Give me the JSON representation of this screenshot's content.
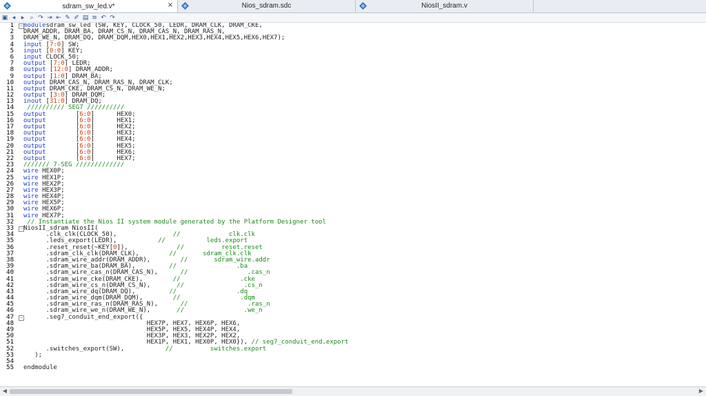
{
  "tabs": [
    {
      "label": "sdram_sw_led.v*",
      "active": true,
      "width": 258
    },
    {
      "label": "Nios_sdram.sdc",
      "active": false,
      "width": 258
    },
    {
      "label": "NiosII_sdram.v",
      "active": false,
      "width": 258
    }
  ],
  "tab_close_glyph": "×",
  "editor": {
    "lines": [
      {
        "n": "1",
        "fold": "minus",
        "seg": [
          [
            "kw",
            "module"
          ],
          [
            "",
            "sdram_sw_led (SW, KEY, CLOCK_50, LEDR, DRAM_CLK, DRAM_CKE,"
          ]
        ]
      },
      {
        "n": "2",
        "seg": [
          [
            "",
            "DRAM_ADDR, DRAM_BA, DRAM_CS_N, DRAM_CAS_N, DRAM_RAS_N,"
          ]
        ]
      },
      {
        "n": "3",
        "seg": [
          [
            "",
            "DRAM_WE_N, DRAM_DQ, DRAM_DQM,HEX0,HEX1,HEX2,HEX3,HEX4,HEX5,HEX6,HEX7);"
          ]
        ]
      },
      {
        "n": "4",
        "seg": [
          [
            "kw",
            "input"
          ],
          [
            "",
            " "
          ],
          [
            "",
            "["
          ],
          [
            "num",
            "7:0"
          ],
          [
            "",
            "] SW;"
          ]
        ]
      },
      {
        "n": "5",
        "seg": [
          [
            "kw",
            "input"
          ],
          [
            "",
            " ["
          ],
          [
            "num",
            "0:0"
          ],
          [
            "",
            "] KEY;"
          ]
        ]
      },
      {
        "n": "6",
        "seg": [
          [
            "kw",
            "input"
          ],
          [
            "",
            " CLOCK_50;"
          ]
        ]
      },
      {
        "n": "7",
        "seg": [
          [
            "kw",
            "output"
          ],
          [
            "",
            " ["
          ],
          [
            "num",
            "7:0"
          ],
          [
            "",
            "] LEDR;"
          ]
        ]
      },
      {
        "n": "8",
        "seg": [
          [
            "kw",
            "output"
          ],
          [
            "",
            " ["
          ],
          [
            "num",
            "12:0"
          ],
          [
            "",
            "] DRAM_ADDR;"
          ]
        ]
      },
      {
        "n": "9",
        "seg": [
          [
            "kw",
            "output"
          ],
          [
            "",
            " ["
          ],
          [
            "num",
            "1:0"
          ],
          [
            "",
            "] DRAM_BA;"
          ]
        ]
      },
      {
        "n": "10",
        "seg": [
          [
            "kw",
            "output"
          ],
          [
            "",
            " DRAM_CAS_N, DRAM_RAS_N, DRAM_CLK;"
          ]
        ]
      },
      {
        "n": "11",
        "seg": [
          [
            "kw",
            "output"
          ],
          [
            "",
            " DRAM_CKE, DRAM_CS_N, DRAM_WE_N;"
          ]
        ]
      },
      {
        "n": "12",
        "seg": [
          [
            "kw",
            "output"
          ],
          [
            "",
            " ["
          ],
          [
            "num",
            "3:0"
          ],
          [
            "",
            "] DRAM_DQM;"
          ]
        ]
      },
      {
        "n": "13",
        "seg": [
          [
            "kw",
            "inout"
          ],
          [
            "",
            " ["
          ],
          [
            "num",
            "31:0"
          ],
          [
            "",
            "] DRAM_DQ;"
          ]
        ]
      },
      {
        "n": "14",
        "seg": [
          [
            "cm",
            " ////////// SEG7 //////////"
          ]
        ]
      },
      {
        "n": "15",
        "seg": [
          [
            "kw",
            "output"
          ],
          [
            "",
            "        ["
          ],
          [
            "num",
            "6:0"
          ],
          [
            "",
            "]      HEX0;"
          ]
        ]
      },
      {
        "n": "16",
        "seg": [
          [
            "kw",
            "output"
          ],
          [
            "",
            "        ["
          ],
          [
            "num",
            "6:0"
          ],
          [
            "",
            "]      HEX1;"
          ]
        ]
      },
      {
        "n": "17",
        "seg": [
          [
            "kw",
            "output"
          ],
          [
            "",
            "        ["
          ],
          [
            "num",
            "6:0"
          ],
          [
            "",
            "]      HEX2;"
          ]
        ]
      },
      {
        "n": "18",
        "seg": [
          [
            "kw",
            "output"
          ],
          [
            "",
            "        ["
          ],
          [
            "num",
            "6:0"
          ],
          [
            "",
            "]      HEX3;"
          ]
        ]
      },
      {
        "n": "19",
        "seg": [
          [
            "kw",
            "output"
          ],
          [
            "",
            "        ["
          ],
          [
            "num",
            "6:0"
          ],
          [
            "",
            "]      HEX4;"
          ]
        ]
      },
      {
        "n": "20",
        "seg": [
          [
            "kw",
            "output"
          ],
          [
            "",
            "        ["
          ],
          [
            "num",
            "6:0"
          ],
          [
            "",
            "]      HEX5;"
          ]
        ]
      },
      {
        "n": "21",
        "seg": [
          [
            "kw",
            "output"
          ],
          [
            "",
            "        ["
          ],
          [
            "num",
            "6:0"
          ],
          [
            "",
            "]      HEX6;"
          ]
        ]
      },
      {
        "n": "22",
        "seg": [
          [
            "kw",
            "output"
          ],
          [
            "",
            "        ["
          ],
          [
            "num",
            "6:0"
          ],
          [
            "",
            "]      HEX7;"
          ]
        ]
      },
      {
        "n": "23",
        "seg": [
          [
            "cm",
            "/////// 7-SEG /////////////"
          ]
        ]
      },
      {
        "n": "24",
        "seg": [
          [
            "kw",
            "wire"
          ],
          [
            "",
            " HEX0P;"
          ]
        ]
      },
      {
        "n": "25",
        "seg": [
          [
            "kw",
            "wire"
          ],
          [
            "",
            " HEX1P;"
          ]
        ]
      },
      {
        "n": "26",
        "seg": [
          [
            "kw",
            "wire"
          ],
          [
            "",
            " HEX2P;"
          ]
        ]
      },
      {
        "n": "27",
        "seg": [
          [
            "kw",
            "wire"
          ],
          [
            "",
            " HEX3P;"
          ]
        ]
      },
      {
        "n": "28",
        "seg": [
          [
            "kw",
            "wire"
          ],
          [
            "",
            " HEX4P;"
          ]
        ]
      },
      {
        "n": "29",
        "seg": [
          [
            "kw",
            "wire"
          ],
          [
            "",
            " HEX5P;"
          ]
        ]
      },
      {
        "n": "30",
        "seg": [
          [
            "kw",
            "wire"
          ],
          [
            "",
            " HEX6P;"
          ]
        ]
      },
      {
        "n": "31",
        "seg": [
          [
            "kw",
            "wire"
          ],
          [
            "",
            " HEX7P;"
          ]
        ]
      },
      {
        "n": "32",
        "seg": [
          [
            "cm",
            " // Instantiate the Nios II system module generated by the Platform Designer tool"
          ]
        ]
      },
      {
        "n": "33",
        "fold": "minus",
        "seg": [
          [
            "",
            "NiosII_sdram NiosII("
          ]
        ]
      },
      {
        "n": "34",
        "seg": [
          [
            "",
            "      .clk_clk(CLOCK_50),               "
          ],
          [
            "cm",
            "//             clk.clk"
          ]
        ]
      },
      {
        "n": "35",
        "seg": [
          [
            "",
            "      .leds_export(LEDR),           "
          ],
          [
            "cm",
            "//           leds.export"
          ]
        ]
      },
      {
        "n": "36",
        "seg": [
          [
            "",
            "      .reset_reset(~KEY["
          ],
          [
            "num",
            "0"
          ],
          [
            "",
            "]),             "
          ],
          [
            "cm",
            "//          reset.reset"
          ]
        ]
      },
      {
        "n": "37",
        "seg": [
          [
            "",
            "      .sdram_clk_clk(DRAM_CLK),        "
          ],
          [
            "cm",
            "//       sdram_clk.clk"
          ]
        ]
      },
      {
        "n": "38",
        "seg": [
          [
            "",
            "      .sdram_wire_addr(DRAM_ADDR),        "
          ],
          [
            "cm",
            "//       sdram_wire.addr"
          ]
        ]
      },
      {
        "n": "39",
        "seg": [
          [
            "",
            "      .sdram_wire_ba(DRAM_BA),         "
          ],
          [
            "cm",
            "//                .ba"
          ]
        ]
      },
      {
        "n": "40",
        "seg": [
          [
            "",
            "      .sdram_wire_cas_n(DRAM_CAS_N),      "
          ],
          [
            "cm",
            "//                .cas_n"
          ]
        ]
      },
      {
        "n": "41",
        "seg": [
          [
            "",
            "      .sdram_wire_cke(DRAM_CKE),        "
          ],
          [
            "cm",
            "//                .cke"
          ]
        ]
      },
      {
        "n": "42",
        "seg": [
          [
            "",
            "      .sdram_wire_cs_n(DRAM_CS_N),       "
          ],
          [
            "cm",
            "//                .cs_n"
          ]
        ]
      },
      {
        "n": "43",
        "seg": [
          [
            "",
            "      .sdram_wire_dq(DRAM_DQ),         "
          ],
          [
            "cm",
            "//                .dq"
          ]
        ]
      },
      {
        "n": "44",
        "seg": [
          [
            "",
            "      .sdram_wire_dqm(DRAM_DQM),        "
          ],
          [
            "cm",
            "//                .dqm"
          ]
        ]
      },
      {
        "n": "45",
        "seg": [
          [
            "",
            "      .sdram_wire_ras_n(DRAM_RAS_N),      "
          ],
          [
            "cm",
            "//                .ras_n"
          ]
        ]
      },
      {
        "n": "46",
        "seg": [
          [
            "",
            "      .sdram_wire_we_n(DRAM_WE_N),       "
          ],
          [
            "cm",
            "//                .we_n"
          ]
        ]
      },
      {
        "n": "47",
        "fold": "minus",
        "seg": [
          [
            "",
            "      .seg7_conduit_end_export({"
          ]
        ]
      },
      {
        "n": "48",
        "seg": [
          [
            "",
            "                                 HEX7P, HEX7, HEX6P, HEX6,"
          ]
        ]
      },
      {
        "n": "49",
        "seg": [
          [
            "",
            "                                 HEX5P, HEX5, HEX4P, HEX4,"
          ]
        ]
      },
      {
        "n": "50",
        "seg": [
          [
            "",
            "                                 HEX3P, HEX3, HEX2P, HEX2,"
          ]
        ]
      },
      {
        "n": "51",
        "seg": [
          [
            "",
            "                                 HEX1P, HEX1, HEX0P, HEX0}), "
          ],
          [
            "cm",
            "// seg7_conduit_end.export"
          ]
        ]
      },
      {
        "n": "52",
        "seg": [
          [
            "",
            "      .switches_export(SW),           "
          ],
          [
            "cm",
            "//          switches.export"
          ]
        ]
      },
      {
        "n": "53",
        "seg": [
          [
            "",
            "   );"
          ]
        ]
      },
      {
        "n": "54",
        "seg": [
          [
            "",
            ""
          ]
        ]
      },
      {
        "n": "55",
        "seg": [
          [
            "",
            "endmodule"
          ]
        ]
      }
    ]
  },
  "colors": {
    "keyword": "#1f3fd0",
    "number": "#c8400a",
    "comment": "#1a8a1a",
    "tab_icon": "#2d6fc4"
  },
  "toolbar_icons": [
    "toggle-bookmark-icon",
    "prev-bookmark-icon",
    "next-bookmark-icon",
    "find-icon",
    "find-next-icon",
    "indent-icon",
    "outdent-icon",
    "comment-icon",
    "uncomment-icon",
    "insert-template-icon",
    "lines-icon",
    "undo-icon",
    "redo-icon"
  ]
}
